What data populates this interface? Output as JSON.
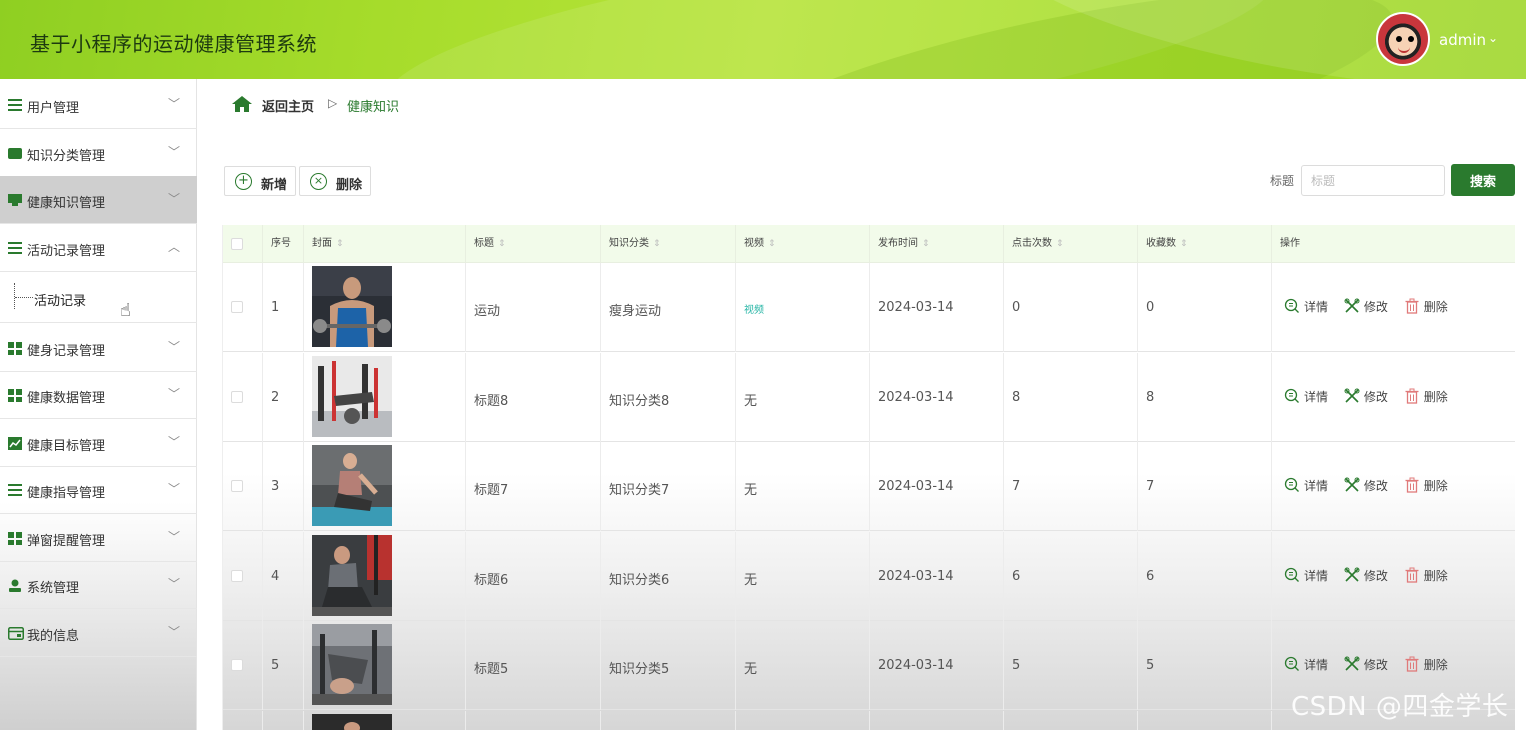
{
  "header": {
    "title": "基于小程序的运动健康管理系统",
    "username": "admin",
    "caret": "⌄"
  },
  "sidebar": {
    "items": [
      {
        "label": "用户管理",
        "icon": "list-icon"
      },
      {
        "label": "知识分类管理",
        "icon": "wallet-icon"
      },
      {
        "label": "健康知识管理",
        "icon": "monitor-icon",
        "active": true
      },
      {
        "label": "活动记录管理",
        "icon": "sliders-icon",
        "expanded": true
      },
      {
        "label": "健身记录管理",
        "icon": "grid-icon"
      },
      {
        "label": "健康数据管理",
        "icon": "grid-icon"
      },
      {
        "label": "健康目标管理",
        "icon": "chart-icon"
      },
      {
        "label": "健康指导管理",
        "icon": "list-icon"
      },
      {
        "label": "弹窗提醒管理",
        "icon": "grid-icon"
      },
      {
        "label": "系统管理",
        "icon": "user-icon"
      },
      {
        "label": "我的信息",
        "icon": "card-icon"
      }
    ],
    "submenu": {
      "label": "活动记录"
    }
  },
  "breadcrumb": {
    "home": "返回主页",
    "separator": "▷",
    "current": "健康知识"
  },
  "toolbar": {
    "add_label": "新增",
    "delete_label": "删除",
    "search_label": "标题",
    "search_placeholder": "标题",
    "search_button": "搜索"
  },
  "table": {
    "columns": [
      "序号",
      "封面",
      "标题",
      "知识分类",
      "视频",
      "发布时间",
      "点击次数",
      "收藏数",
      "操作"
    ],
    "rows": [
      {
        "index": "1",
        "title": "运动",
        "category": "瘦身运动",
        "video": "视频",
        "date": "2024-03-14",
        "clicks": "0",
        "favorites": "0"
      },
      {
        "index": "2",
        "title": "标题8",
        "category": "知识分类8",
        "video": "无",
        "date": "2024-03-14",
        "clicks": "8",
        "favorites": "8"
      },
      {
        "index": "3",
        "title": "标题7",
        "category": "知识分类7",
        "video": "无",
        "date": "2024-03-14",
        "clicks": "7",
        "favorites": "7"
      },
      {
        "index": "4",
        "title": "标题6",
        "category": "知识分类6",
        "video": "无",
        "date": "2024-03-14",
        "clicks": "6",
        "favorites": "6"
      },
      {
        "index": "5",
        "title": "标题5",
        "category": "知识分类5",
        "video": "无",
        "date": "2024-03-14",
        "clicks": "5",
        "favorites": "5"
      }
    ],
    "actions": {
      "detail": "详情",
      "edit": "修改",
      "delete": "删除"
    }
  },
  "watermark": "CSDN @四金学长",
  "colors": {
    "accent": "#2a7a2e",
    "header": "#a6dc2b",
    "video_link": "#26b5a5",
    "delete": "#e07a7a"
  }
}
